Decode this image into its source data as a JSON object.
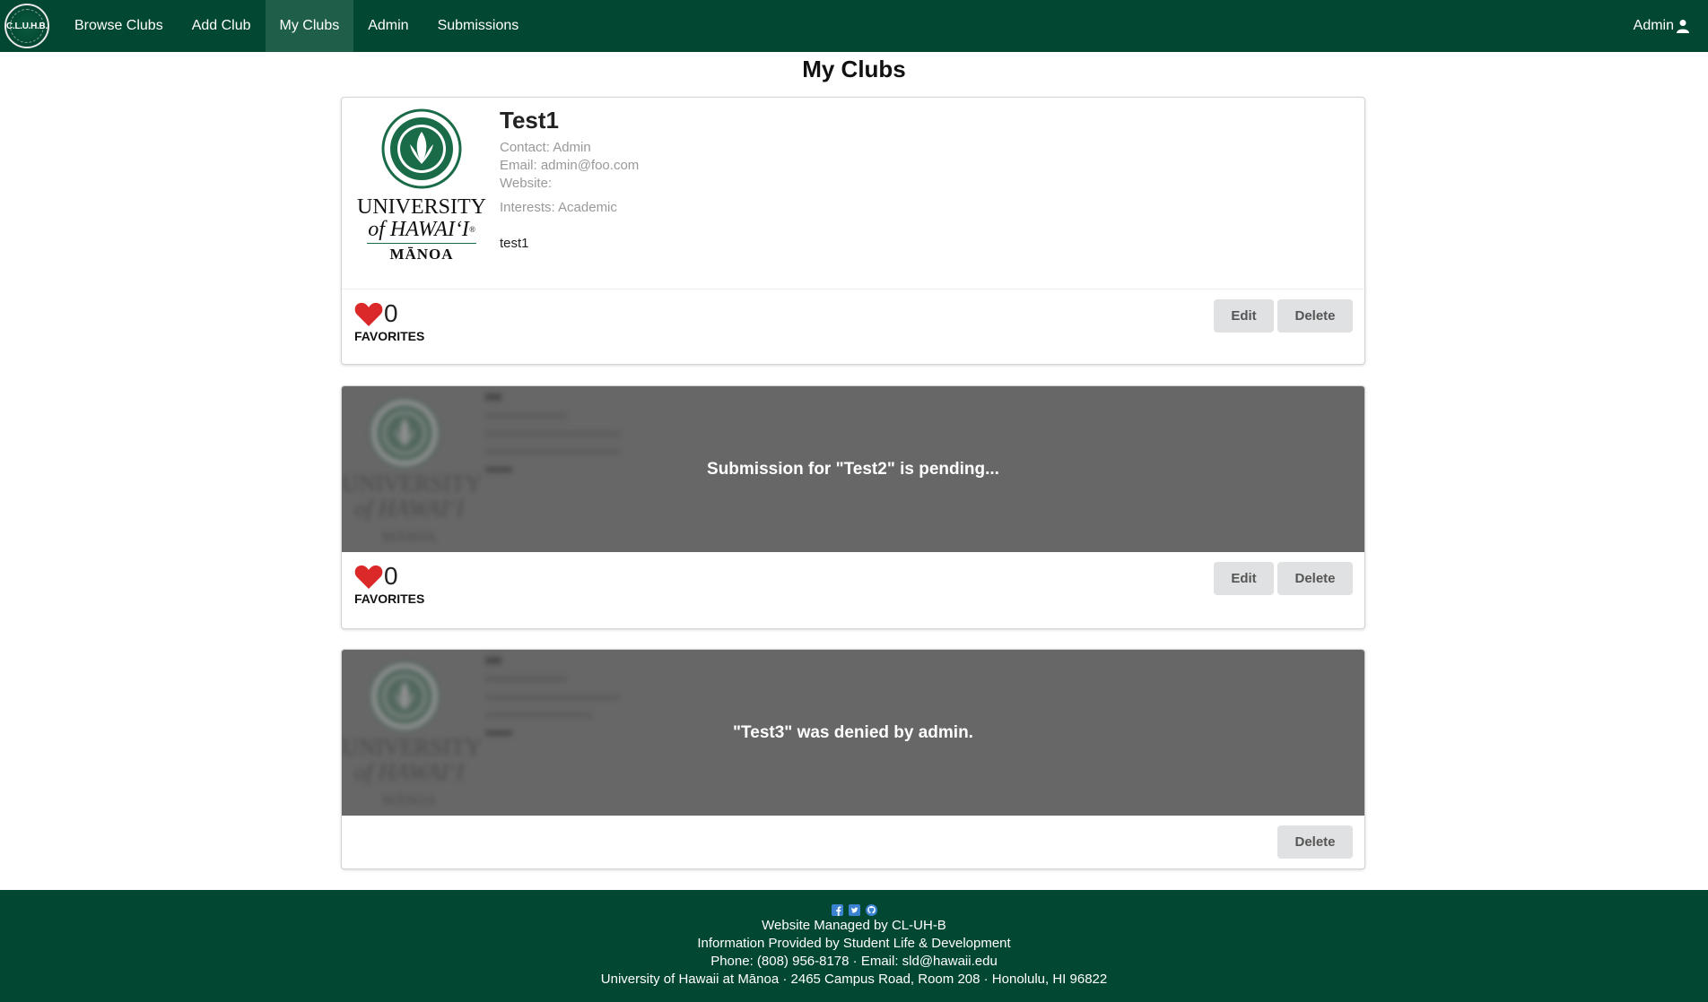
{
  "nav": {
    "logo_text": "C.L.U.H.B.",
    "items": [
      {
        "label": "Browse Clubs"
      },
      {
        "label": "Add Club"
      },
      {
        "label": "My Clubs"
      },
      {
        "label": "Admin"
      },
      {
        "label": "Submissions"
      }
    ],
    "active_index": 2,
    "user_label": "Admin"
  },
  "page_title": "My Clubs",
  "university_logo_text": [
    "UNIVERSITY",
    "of HAWAI‘I®",
    "MĀNOA"
  ],
  "cards": [
    {
      "name": "Test1",
      "contact": "Contact: Admin",
      "email": "Email: admin@foo.com",
      "website": "Website:",
      "interests": "Interests: Academic",
      "description": "test1",
      "favorites_count": "0",
      "favorites_label": "FAVORITES",
      "edit_label": "Edit",
      "delete_label": "Delete"
    },
    {
      "status_text": "Submission for \"Test2\" is pending...",
      "favorites_count": "0",
      "favorites_label": "FAVORITES",
      "edit_label": "Edit",
      "delete_label": "Delete"
    },
    {
      "status_text": "\"Test3\" was denied by admin.",
      "delete_label": "Delete"
    }
  ],
  "footer": {
    "icons": [
      "facebook-icon",
      "twitter-icon",
      "github-icon"
    ],
    "lines": [
      "Website Managed by CL-UH-B",
      "Information Provided by Student Life & Development",
      "Phone: (808) 956-8178 · Email: sld@hawaii.edu",
      "University of Hawaii at Mānoa · 2465 Campus Road, Room 208 · Honolulu, HI 96822"
    ]
  },
  "colors": {
    "brand_green": "#024731",
    "active_tab": "#1f5f4a",
    "overlay_gray": "#676767",
    "heart_red": "#db2828",
    "button_gray": "#e0e1e2"
  }
}
